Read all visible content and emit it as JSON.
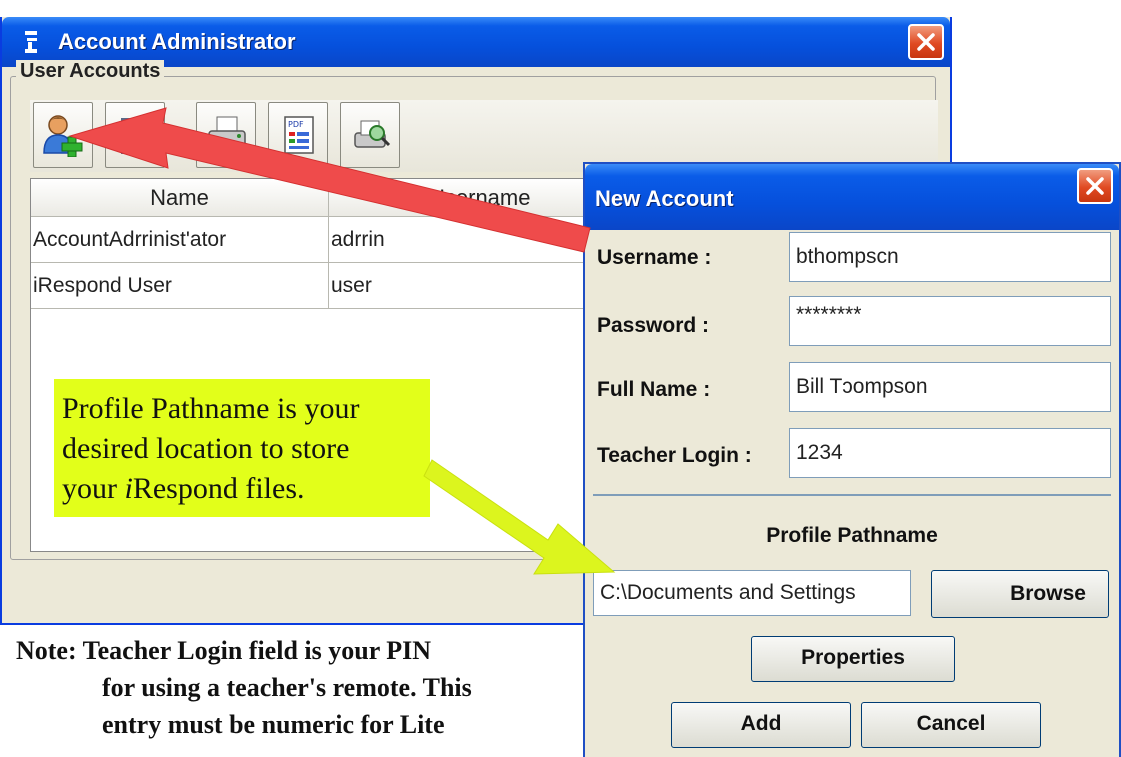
{
  "main_window": {
    "title": "Account Administrator",
    "group_title": "User Accounts",
    "toolbar_icons": [
      "add-user-icon",
      "edit-user-icon",
      "print-icon",
      "pdf-icon",
      "print-preview-icon"
    ],
    "table": {
      "columns": [
        "Name",
        "Username"
      ],
      "rows": [
        [
          "AccountAdrrinist'ator",
          "adrrin"
        ],
        [
          "iRespond User",
          "user"
        ]
      ]
    }
  },
  "callout": {
    "lines": [
      "Profile Pathname is your",
      "desired location to store",
      "your ",
      "iRespond files."
    ],
    "italic_prefix": "i",
    "line3_prefix": "your ",
    "line3_italic": "i",
    "line3_rest": "Respond files."
  },
  "note": {
    "lines": [
      "Note: Teacher Login field is your PIN",
      "for using a teacher's remote.  This",
      "entry must be numeric for Lite"
    ]
  },
  "dialog": {
    "title": "New Account",
    "fields": {
      "username": {
        "label": "Username :",
        "value": "bthompscn"
      },
      "password": {
        "label": "Password :",
        "value": "********"
      },
      "full_name": {
        "label": "Full Name :",
        "value": "Bill Tɔompson"
      },
      "teacher_login": {
        "label": "Teacher Login :",
        "value": "1234"
      }
    },
    "profile_pathname_label": "Profile Pathname",
    "profile_path_value": "C:\\Documents and Settings",
    "browse_label": "Browse",
    "properties_label": "Properties",
    "add_label": "Add",
    "cancel_label": "Cancel"
  },
  "colors": {
    "titlebar": "#0a5ce8",
    "callout": "#e2ff1a",
    "red_arrow": "#ef4b4b",
    "yellow_arrow": "#dcf51e"
  }
}
